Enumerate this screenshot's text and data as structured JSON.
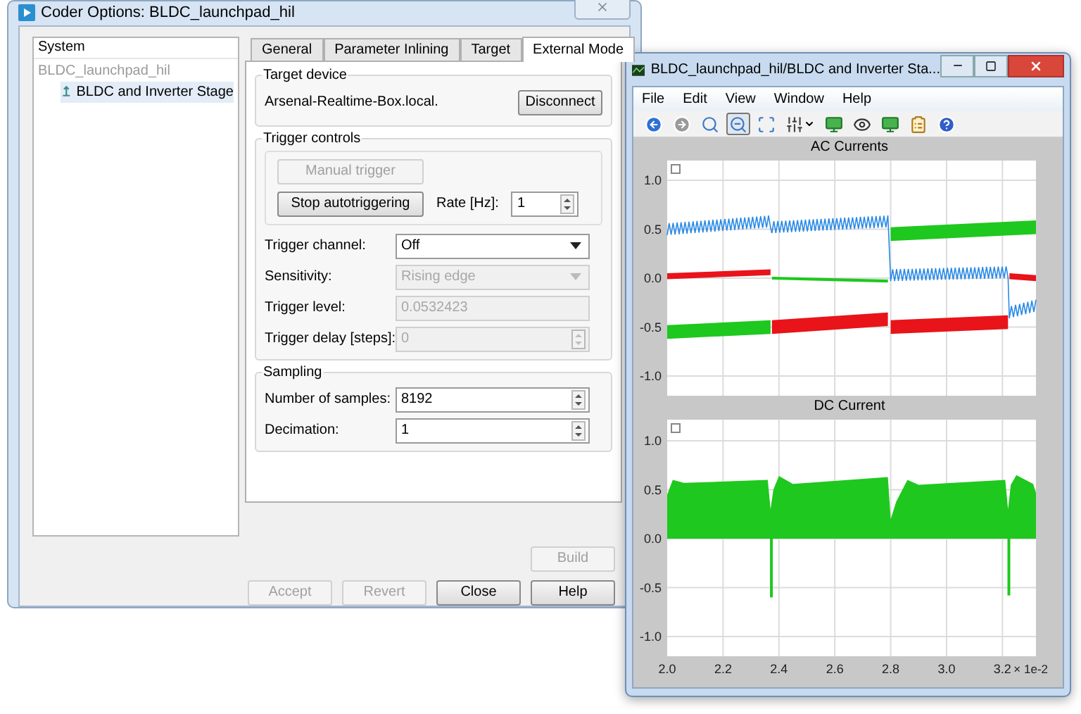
{
  "dialog": {
    "title": "Coder Options: BLDC_launchpad_hil",
    "tree": {
      "header": "System",
      "items": [
        {
          "label": "BLDC_launchpad_hil",
          "disabled": true,
          "selected": false,
          "children": [
            {
              "label": "BLDC and Inverter Stage",
              "disabled": false,
              "selected": true
            }
          ]
        }
      ]
    },
    "tabs": [
      {
        "label": "General",
        "selected": false
      },
      {
        "label": "Parameter Inlining",
        "selected": false
      },
      {
        "label": "Target",
        "selected": false
      },
      {
        "label": "External Mode",
        "selected": true
      }
    ],
    "target_device": {
      "title": "Target device",
      "host": "Arsenal-Realtime-Box.local.",
      "button": "Disconnect"
    },
    "trigger_controls": {
      "title": "Trigger controls",
      "manual_button": {
        "label": "Manual trigger",
        "disabled": true
      },
      "auto_button": {
        "label": "Stop autotriggering",
        "disabled": false
      },
      "rate": {
        "label": "Rate [Hz]:",
        "value": "1"
      },
      "fields": [
        {
          "label": "Trigger channel:",
          "kind": "dropdown",
          "value": "Off",
          "disabled": false
        },
        {
          "label": "Sensitivity:",
          "kind": "dropdown",
          "value": "Rising edge",
          "disabled": true
        },
        {
          "label": "Trigger level:",
          "kind": "text",
          "value": "0.0532423",
          "disabled": true
        },
        {
          "label": "Trigger delay [steps]:",
          "kind": "spin",
          "value": "0",
          "disabled": true
        }
      ]
    },
    "sampling": {
      "title": "Sampling",
      "fields": [
        {
          "label": "Number of samples:",
          "value": "8192"
        },
        {
          "label": "Decimation:",
          "value": "1"
        }
      ]
    },
    "build_button": {
      "label": "Build",
      "disabled": true
    },
    "buttons": [
      {
        "label": "Accept",
        "disabled": true
      },
      {
        "label": "Revert",
        "disabled": true
      },
      {
        "label": "Close",
        "disabled": false
      },
      {
        "label": "Help",
        "disabled": false
      }
    ]
  },
  "scope": {
    "title": "BLDC_launchpad_hil/BLDC and Inverter Sta...",
    "menu": [
      "File",
      "Edit",
      "View",
      "Window",
      "Help"
    ],
    "toolbar": [
      {
        "kind": "back",
        "selected": false
      },
      {
        "kind": "forward",
        "selected": false
      },
      {
        "kind": "zoom",
        "selected": false
      },
      {
        "kind": "zoom-out",
        "selected": true
      },
      {
        "kind": "fit",
        "selected": false
      },
      {
        "kind": "cursor",
        "selected": false
      },
      {
        "kind": "monitor",
        "selected": false
      },
      {
        "kind": "eye",
        "selected": false
      },
      {
        "kind": "export",
        "selected": false
      },
      {
        "kind": "notes",
        "selected": false
      },
      {
        "kind": "help",
        "selected": false
      }
    ],
    "plots": [
      {
        "title": "AC Currents",
        "kind": "ac",
        "yticks": [
          "1.0",
          "0.5",
          "0.0",
          "-0.5",
          "-1.0"
        ]
      },
      {
        "title": "DC Current",
        "kind": "dc",
        "yticks": [
          "1.0",
          "0.5",
          "0.0",
          "-0.5",
          "-1.0"
        ],
        "xticks": [
          "2.0",
          "2.2",
          "2.4",
          "2.6",
          "2.8",
          "3.0",
          "3.2"
        ],
        "xscale": "× 1e-2"
      }
    ]
  }
}
